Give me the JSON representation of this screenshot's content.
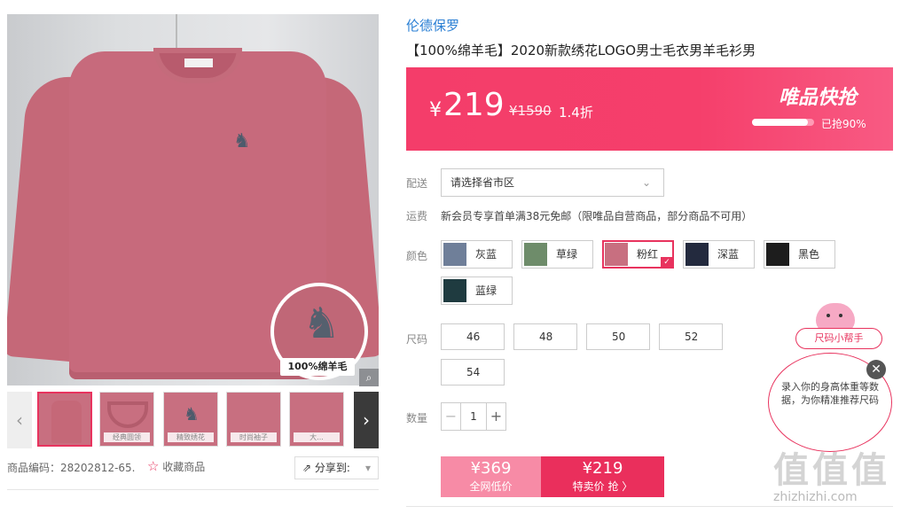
{
  "gallery": {
    "badge": "100%绵羊毛",
    "thumbnails": [
      {
        "caption": ""
      },
      {
        "caption": "经典圆领"
      },
      {
        "caption": "精致绣花"
      },
      {
        "caption": "时尚袖子"
      },
      {
        "caption": "大..."
      },
      {
        "caption": "..."
      }
    ],
    "product_code": "商品编码：28202812-65.",
    "favorite_label": "收藏商品",
    "share_label": "分享到:"
  },
  "product": {
    "brand": "伦德保罗",
    "title": "【100%绵羊毛】2020新款绣花LOGO男士毛衣男羊毛衫男"
  },
  "price_banner": {
    "currency": "¥",
    "price": "219",
    "original_price": "¥1590",
    "discount": "1.4折",
    "flash_label": "唯品快抢",
    "sold_fraction": 0.9,
    "sold_label": "已抢90%"
  },
  "delivery": {
    "label": "配送",
    "select_value": "请选择省市区"
  },
  "shipping": {
    "label": "运费",
    "text": "新会员专享首单满38元免邮（限唯品自营商品，部分商品不可用）"
  },
  "colors": {
    "label": "颜色",
    "options": [
      {
        "name": "灰蓝",
        "color": "#6f7f99"
      },
      {
        "name": "草绿",
        "color": "#6e8c6a"
      },
      {
        "name": "粉红",
        "color": "#c86f80"
      },
      {
        "name": "深蓝",
        "color": "#232a3e"
      },
      {
        "name": "黑色",
        "color": "#1d1d1d"
      },
      {
        "name": "蓝绿",
        "color": "#1f3b40"
      }
    ],
    "selected": "粉红"
  },
  "sizes": {
    "label": "尺码",
    "options": [
      "46",
      "48",
      "50",
      "52",
      "54"
    ]
  },
  "quantity": {
    "label": "数量",
    "value": "1",
    "minus": "−",
    "plus": "+"
  },
  "buy": {
    "normal_price": "¥369",
    "normal_label": "全网低价",
    "special_price": "¥219",
    "special_label": "特卖价 抢 〉"
  },
  "size_helper": {
    "tag": "尺码小帮手",
    "bubble": "录入你的身高体重等数据，为你精准推荐尺码",
    "close": "✕"
  },
  "watermark": {
    "big": "值值值",
    "url": "zhizhizhi.com"
  },
  "theme": {
    "accent": "#e8335e",
    "brand_link": "#2a7fd4"
  }
}
